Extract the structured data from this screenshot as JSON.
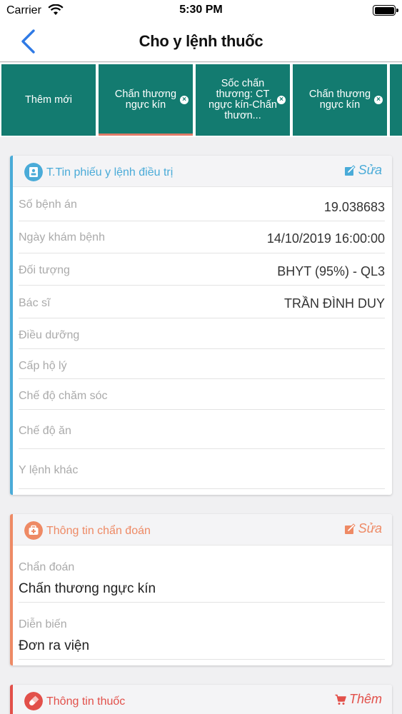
{
  "status_bar": {
    "carrier": "Carrier",
    "time": "5:30 PM"
  },
  "nav": {
    "title": "Cho y lệnh thuốc"
  },
  "tabs": [
    {
      "label": "Thêm mới"
    },
    {
      "label": "Chấn thương ngực kín"
    },
    {
      "label": "Sốc chấn thương: CT ngực kín-Chấn thươn..."
    },
    {
      "label": "Chấn thương ngực kín"
    }
  ],
  "colors": {
    "teal": "#137b70",
    "blue_accent": "#4aabd8",
    "orange_accent": "#ee8a65",
    "red_accent": "#e2504a"
  },
  "card_ticket": {
    "title": "T.Tin phiếu y lệnh điều trị",
    "edit_label": "Sửa",
    "rows": [
      {
        "label": "Số bệnh án",
        "value": "19.038683"
      },
      {
        "label": "Ngày khám bệnh",
        "value": "14/10/2019 16:00:00"
      },
      {
        "label": "Đối tượng",
        "value": "BHYT (95%) - QL3"
      },
      {
        "label": "Bác sĩ",
        "value": "TRẦN ĐÌNH DUY"
      },
      {
        "label": "Điều dưỡng",
        "value": ""
      },
      {
        "label": "Cấp hộ lý",
        "value": ""
      },
      {
        "label": "Chế độ chăm sóc",
        "value": ""
      },
      {
        "label": "Chế độ ăn",
        "value": ""
      },
      {
        "label": "Y lệnh khác",
        "value": ""
      }
    ]
  },
  "card_diagnosis": {
    "title": "Thông tin chẩn đoán",
    "edit_label": "Sửa",
    "diagnosis_label": "Chẩn đoán",
    "diagnosis_value": "Chấn thương ngực kín",
    "progress_label": "Diễn biến",
    "progress_value": "Đơn ra viện"
  },
  "card_medicine": {
    "title": "Thông tin thuốc",
    "add_label": "Thêm"
  }
}
